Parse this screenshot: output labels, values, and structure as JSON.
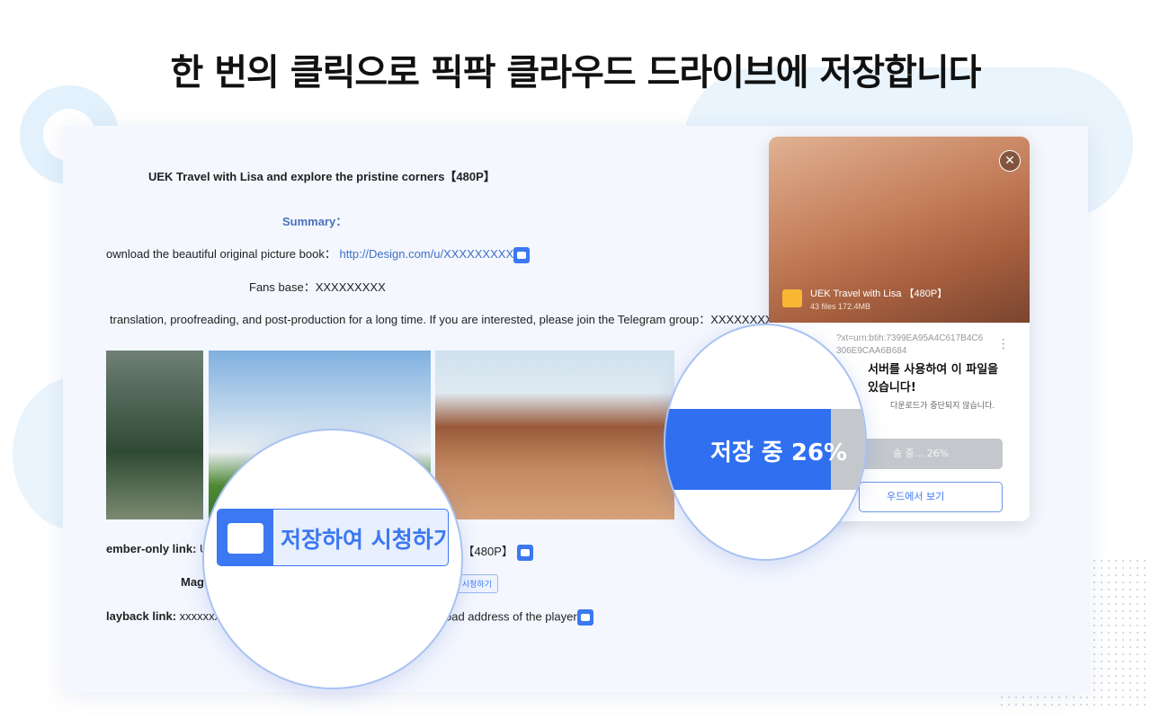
{
  "headline": "한 번의 클릭으로 픽팍 클라우드 드라이브에 저장합니다",
  "doc": {
    "title": "UEK Travel with Lisa and explore the pristine corners【480P】",
    "summary": "Summary：",
    "download_label": "ownload the beautiful original picture book：",
    "download_link": "http://Design.com/u/XXXXXXXXX",
    "fans": "Fans base：XXXXXXXXX",
    "translation": "translation, proofreading, and post-production for a long time. If you are interested, please join the Telegram group：XXXXXXXX",
    "member_label": "ember-only link:",
    "member_value_start": "U",
    "member_value_end": "s【480P】",
    "magnet_label": "Mag",
    "magnet_button": "여 시청하기",
    "playback_label": "layback link:",
    "playback_value": "xxxxxxx",
    "playback_end": "oad address of the player"
  },
  "panel": {
    "file_name": "UEK Travel with Lisa 【480P】",
    "file_meta": "43 files  172.4MB",
    "magnet_line1": "?xt=urn:btih:7399EA95A4C617B4C6",
    "magnet_line2": "306E9CAA6B684",
    "heading_line1": "서버를 사용하여 이 파일을",
    "heading_line2": "있습니다!",
    "subtext": "다운로드가 중단되지 않습니다.",
    "progress_text": "송 중... 26%",
    "view_button": "우드에서 보기"
  },
  "zoom_left": {
    "button": "저장하여 시청하기"
  },
  "zoom_right": {
    "progress": "저장 중 26%",
    "progress_percent": 26
  },
  "colors": {
    "accent": "#3b78f2",
    "progress_track": "#c4c7cc"
  }
}
